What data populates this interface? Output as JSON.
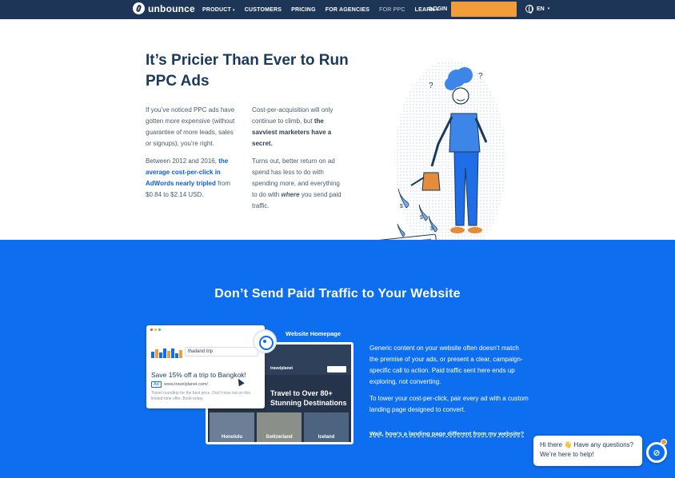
{
  "nav": {
    "logo_text": "unbounce",
    "links": [
      {
        "label": "PRODUCT",
        "caret": "▾"
      },
      {
        "label": "CUSTOMERS",
        "caret": ""
      },
      {
        "label": "PRICING",
        "caret": ""
      },
      {
        "label": "FOR AGENCIES",
        "caret": ""
      },
      {
        "label": "FOR PPC",
        "caret": ""
      },
      {
        "label": "LEARN",
        "caret": "▾"
      }
    ],
    "login": "LOGIN",
    "cta": "",
    "lang": "EN",
    "lang_caret": "▾"
  },
  "hero": {
    "title": "It’s Pricier Than Ever to Run PPC Ads",
    "col1_p1": "If you’ve noticed PPC ads have gotten more expensive (without guarantee of more leads, sales or signups), you’re right.",
    "col1_p2_a": "Between 2012 and 2016, ",
    "col1_p2_hl": "the average cost-per-click in AdWords nearly tripled",
    "col1_p2_b": " from $0.84 to $2.14 USD.",
    "col2_p1_a": "Cost-per-acquisition will only continue to climb, but ",
    "col2_p1_bd": "the savviest marketers have a secret.",
    "col2_p2_a": "Turns out, better return on ad spend has less to do with spending more, and everything to do with ",
    "col2_p2_it": "where",
    "col2_p2_b": " you send paid traffic."
  },
  "blue": {
    "title": "Don’t Send Paid Traffic to Your Website",
    "homepage_label": "Website Homepage",
    "p1": "Generic content on your website often doesn’t match the premise of your ads, or present a clear, campaign-specific call to action. Paid traffic sent here ends up exploring, not converting.",
    "p2": "To lower your cost-per-click, pair every ad with a custom landing page designed to convert.",
    "link": "Wait, how’s a landing page different from my website?"
  },
  "ad_mock": {
    "query": "thailand trip",
    "headline": "Save 15% off a trip to Bangkok!",
    "badge": "Ad",
    "url": "www.travelplanet.com/",
    "desc": "Travel roundtrip for the best price. Don’t miss out on this limited-time offer. Book today."
  },
  "homepage_mock": {
    "logo": "travelplanet",
    "headline": "Travel to Over 80+ Stunning Destinations",
    "tiles": [
      "Honolulu",
      "Switzerland",
      "Iceland"
    ]
  },
  "chat": {
    "text": "Hi there 👋 Have any questions? We’re here to help!",
    "avatar_icon": "unbounce-logo-icon"
  },
  "colors": {
    "nav_bg": "#1d3557",
    "accent_orange": "#f39c3a",
    "brand_blue": "#0e6ef0",
    "heading_navy": "#1a3a5c"
  }
}
